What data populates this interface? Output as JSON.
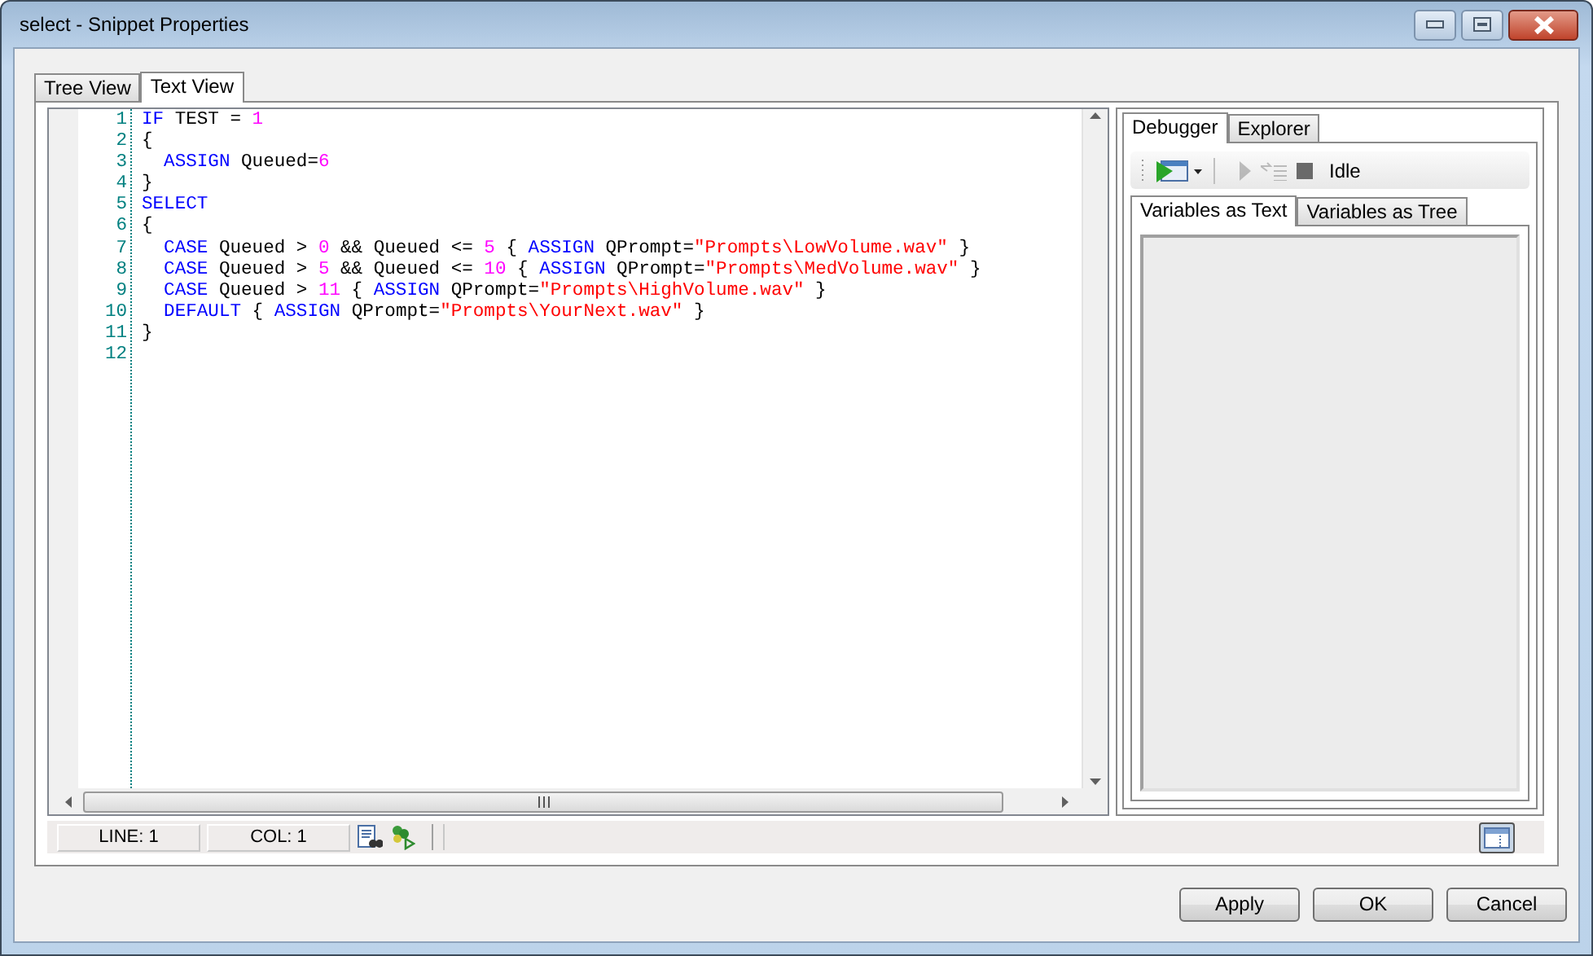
{
  "window": {
    "title": "select - Snippet Properties"
  },
  "tabs": [
    {
      "label": "Tree View",
      "selected": false
    },
    {
      "label": "Text View",
      "selected": true
    }
  ],
  "editor": {
    "lines": [
      {
        "number": "1",
        "tokens": [
          {
            "kind": "keyword",
            "text": "IF"
          },
          {
            "kind": "plain",
            "text": " TEST = "
          },
          {
            "kind": "number",
            "text": "1"
          }
        ]
      },
      {
        "number": "2",
        "tokens": [
          {
            "kind": "plain",
            "text": "{"
          }
        ]
      },
      {
        "number": "3",
        "indented": true,
        "tokens": [
          {
            "kind": "keyword",
            "text": "ASSIGN"
          },
          {
            "kind": "plain",
            "text": " Queued="
          },
          {
            "kind": "number",
            "text": "6"
          }
        ]
      },
      {
        "number": "4",
        "tokens": [
          {
            "kind": "plain",
            "text": "}"
          }
        ]
      },
      {
        "number": "5",
        "tokens": [
          {
            "kind": "keyword",
            "text": "SELECT"
          }
        ]
      },
      {
        "number": "6",
        "tokens": [
          {
            "kind": "plain",
            "text": "{"
          }
        ]
      },
      {
        "number": "7",
        "indented": true,
        "tokens": [
          {
            "kind": "keyword",
            "text": "CASE"
          },
          {
            "kind": "plain",
            "text": " Queued > "
          },
          {
            "kind": "number",
            "text": "0"
          },
          {
            "kind": "plain",
            "text": " && Queued <= "
          },
          {
            "kind": "number",
            "text": "5"
          },
          {
            "kind": "plain",
            "text": " { "
          },
          {
            "kind": "keyword",
            "text": "ASSIGN"
          },
          {
            "kind": "plain",
            "text": " QPrompt="
          },
          {
            "kind": "string",
            "text": "\"Prompts\\LowVolume.wav\""
          },
          {
            "kind": "plain",
            "text": " }"
          }
        ]
      },
      {
        "number": "8",
        "indented": true,
        "tokens": [
          {
            "kind": "keyword",
            "text": "CASE"
          },
          {
            "kind": "plain",
            "text": " Queued > "
          },
          {
            "kind": "number",
            "text": "5"
          },
          {
            "kind": "plain",
            "text": " && Queued <= "
          },
          {
            "kind": "number",
            "text": "10"
          },
          {
            "kind": "plain",
            "text": " { "
          },
          {
            "kind": "keyword",
            "text": "ASSIGN"
          },
          {
            "kind": "plain",
            "text": " QPrompt="
          },
          {
            "kind": "string",
            "text": "\"Prompts\\MedVolume.wav\""
          },
          {
            "kind": "plain",
            "text": " }"
          }
        ]
      },
      {
        "number": "9",
        "indented": true,
        "tokens": [
          {
            "kind": "keyword",
            "text": "CASE"
          },
          {
            "kind": "plain",
            "text": " Queued > "
          },
          {
            "kind": "number",
            "text": "11"
          },
          {
            "kind": "plain",
            "text": " { "
          },
          {
            "kind": "keyword",
            "text": "ASSIGN"
          },
          {
            "kind": "plain",
            "text": " QPrompt="
          },
          {
            "kind": "string",
            "text": "\"Prompts\\HighVolume.wav\""
          },
          {
            "kind": "plain",
            "text": " }"
          }
        ]
      },
      {
        "number": "10",
        "indented": true,
        "tokens": [
          {
            "kind": "keyword",
            "text": "DEFAULT"
          },
          {
            "kind": "plain",
            "text": " { "
          },
          {
            "kind": "keyword",
            "text": "ASSIGN"
          },
          {
            "kind": "plain",
            "text": " QPrompt="
          },
          {
            "kind": "string",
            "text": "\"Prompts\\YourNext.wav\""
          },
          {
            "kind": "plain",
            "text": " }"
          }
        ]
      },
      {
        "number": "11",
        "tokens": [
          {
            "kind": "plain",
            "text": "}"
          }
        ]
      },
      {
        "number": "12"
      }
    ]
  },
  "debugger": {
    "tabs": [
      {
        "label": "Debugger",
        "selected": true
      },
      {
        "label": "Explorer",
        "selected": false
      }
    ],
    "tools": [
      {
        "kind": "run",
        "disabled": false
      },
      {
        "kind": "play",
        "disabled": true
      },
      {
        "kind": "step",
        "disabled": true
      },
      {
        "kind": "stop",
        "disabled": false
      }
    ],
    "state": "Idle",
    "variable_tabs": [
      {
        "label": "Variables as Text",
        "selected": true
      },
      {
        "label": "Variables as Tree",
        "selected": false
      }
    ]
  },
  "status_bar": {
    "line": "LINE: 1",
    "col": "COL: 1"
  },
  "buttons": [
    "Apply",
    "OK",
    "Cancel"
  ]
}
